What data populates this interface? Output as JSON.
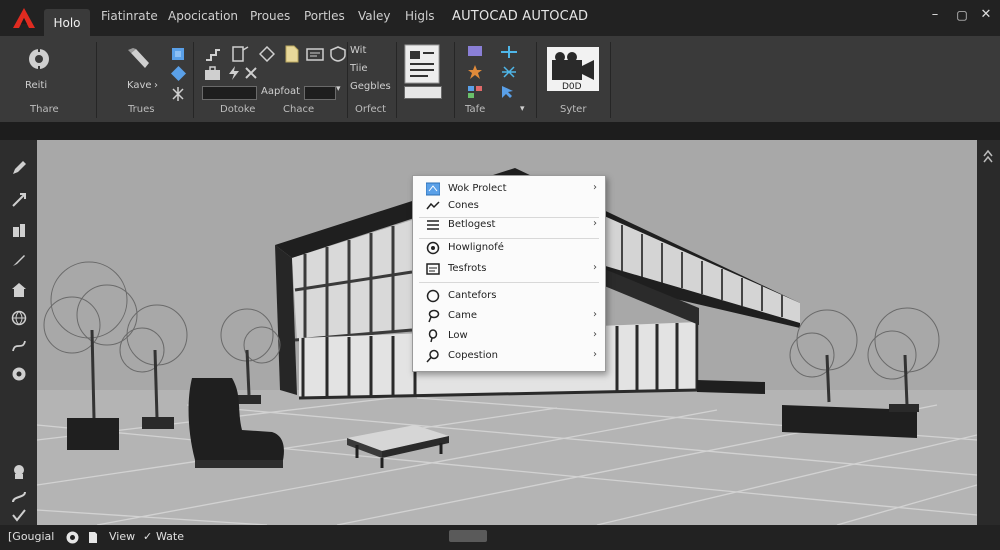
{
  "app": {
    "title": "AUTOCAD AUTOCAD",
    "tabs": [
      "Holo",
      "Fiatinrate",
      "Apocication",
      "Proues",
      "Portles",
      "Valey",
      "Higls"
    ]
  },
  "window": {
    "minimize": "–",
    "maximize": "▢",
    "close": "✕"
  },
  "ribbon": {
    "groups": [
      {
        "label": "Thare",
        "button": "Reiti"
      },
      {
        "label": "Trues",
        "button": "Kave"
      },
      {
        "label": "Dotoke",
        "field_label": "Aapfoat"
      },
      {
        "label": "Chace"
      },
      {
        "label": "Orfect",
        "items": [
          "Wit",
          "Tiie",
          "Gegbles"
        ]
      },
      {
        "label": "Tafe"
      },
      {
        "label": "Syter",
        "button": "D0D"
      }
    ]
  },
  "context_menu": {
    "items": [
      {
        "label": "Wok Prolect",
        "submenu": true,
        "icon": "folder-icon"
      },
      {
        "label": "Cones",
        "submenu": false,
        "icon": "line-icon"
      },
      {
        "label": "Betlogest",
        "submenu": true,
        "icon": "list-icon"
      },
      {
        "label": "Howlignofé",
        "submenu": false,
        "icon": "gear-icon"
      },
      {
        "label": "Tesfrots",
        "submenu": true,
        "icon": "window-icon"
      },
      {
        "label": "Cantefors",
        "submenu": false,
        "icon": "circle-icon"
      },
      {
        "label": "Came",
        "submenu": true,
        "icon": "lasso-icon"
      },
      {
        "label": "Low",
        "submenu": true,
        "icon": "loop-icon"
      },
      {
        "label": "Copestion",
        "submenu": true,
        "icon": "search-icon"
      }
    ]
  },
  "statusbar": {
    "items": [
      "[Gougial",
      "View",
      "Wate"
    ]
  },
  "colors": {
    "accent": "#e02b20",
    "ribbon_bg": "#3a3a3a",
    "viewport_bg": "#a9a9a9",
    "menu_bg": "#fbfbfb"
  }
}
